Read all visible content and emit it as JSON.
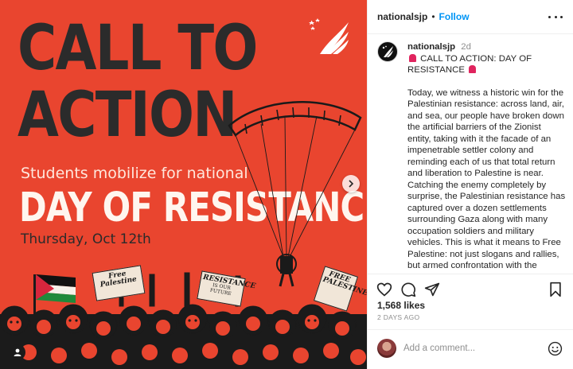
{
  "post": {
    "headline_line1": "CALL TO",
    "headline_line2": "ACTION",
    "subline": "Students mobilize for national",
    "title": "DAY OF RESISTANCE",
    "date": "Thursday, Oct 12th",
    "signs": {
      "sign1": "Free Palestine",
      "sign2_main": "RESISTANCE",
      "sign2_small": "IS OUR FUTURE",
      "sign3": "FREE PALESTINE"
    }
  },
  "header": {
    "username": "nationalsjp",
    "separator": "•",
    "follow_label": "Follow"
  },
  "caption": {
    "username": "nationalsjp",
    "time": "2d",
    "headline": "CALL TO ACTION: DAY OF RESISTANCE",
    "body": "Today, we witness a historic win for the Palestinian resistance: across land, air, and sea, our people have broken down the artificial barriers of the Zionist entity, taking with it the facade of an impenetrable settler colony and reminding each of us that total return and liberation to Palestine is near. Catching the enemy completely by surprise, the Palestinian resistance has captured over a dozen settlements surrounding Gaza along with many occupation soldiers and military vehicles. This is what it means to Free Palestine: not just slogans and rallies, but armed confrontation with the oppressors."
  },
  "stats": {
    "likes": "1,568 likes",
    "posted_ago": "2 DAYS AGO"
  },
  "comment": {
    "placeholder": "Add a comment..."
  },
  "icons": {
    "like": "heart-icon",
    "comment": "comment-icon",
    "share": "paper-plane-icon",
    "save": "bookmark-icon",
    "more": "more-icon",
    "emoji": "smiley-icon",
    "carousel": "chevron-right-icon",
    "tag": "user-tag-icon"
  },
  "colors": {
    "poster_bg": "#e9452f",
    "follow_blue": "#0095f6",
    "text_dark": "#262626",
    "text_muted": "#8e8e8e"
  }
}
